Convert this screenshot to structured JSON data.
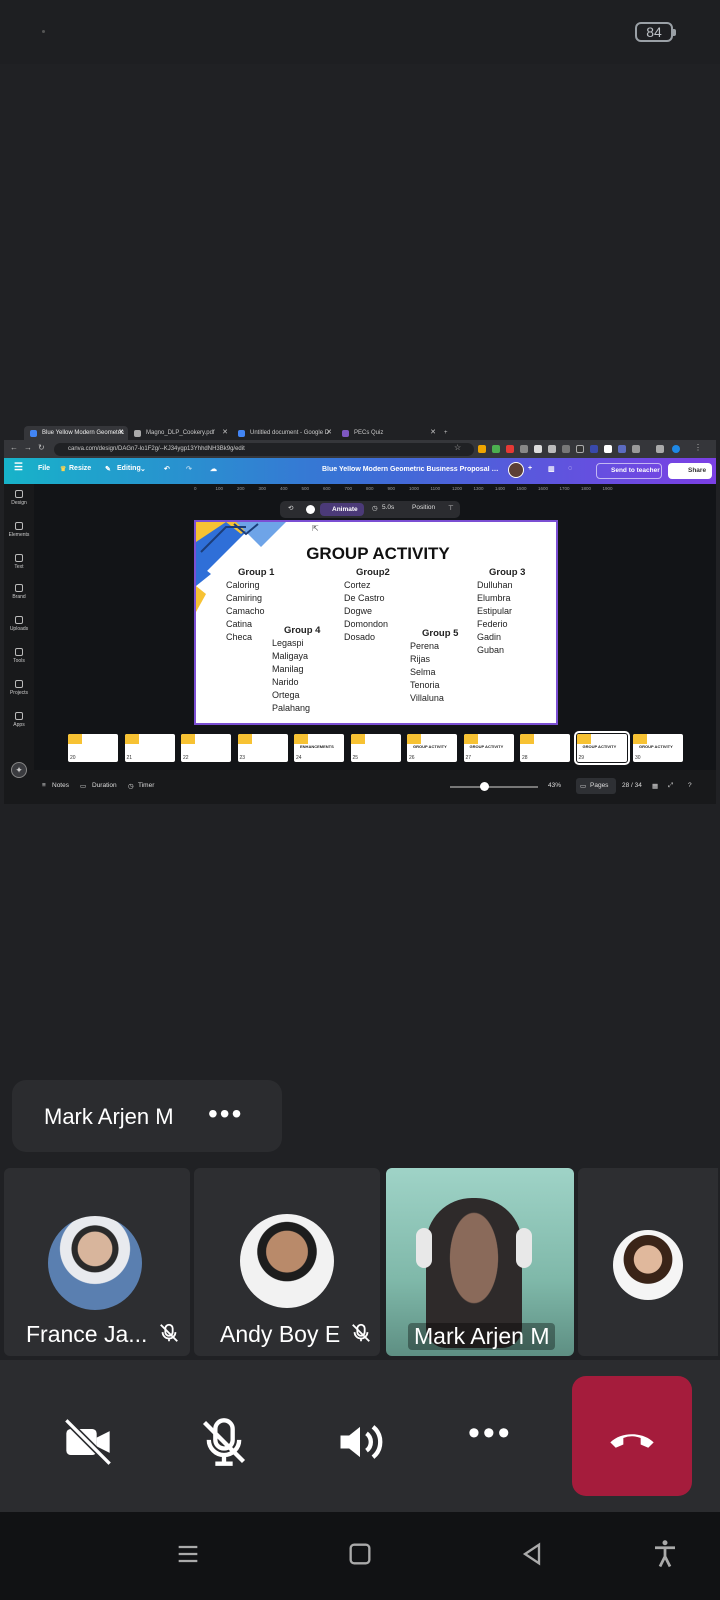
{
  "status_bar": {
    "battery": "84"
  },
  "browser": {
    "tabs": [
      {
        "label": "Blue Yellow Modern Geometric",
        "color": "#4285f4"
      },
      {
        "label": "Magno_DLP_Cookery.pdf",
        "color": "#aaaaaa"
      },
      {
        "label": "Untitled document - Google D",
        "color": "#4285f4"
      },
      {
        "label": "PECs Quiz",
        "color": "#7e57c2"
      }
    ],
    "url": "canva.com/design/DAGn7-lo1F2g/--KJ34ygp13YhhdNH3Bk9g/edit"
  },
  "canva": {
    "menu": {
      "file": "File",
      "resize": "Resize",
      "editing": "Editing"
    },
    "doc_title": "Blue Yellow Modern Geometric Business Proposal Presenta...",
    "send_to_teacher": "Send to teacher",
    "share": "Share",
    "sidebar": [
      "Design",
      "Elements",
      "Text",
      "Brand",
      "Uploads",
      "Tools",
      "Projects",
      "Apps"
    ],
    "ruler": [
      "0",
      "100",
      "200",
      "300",
      "400",
      "500",
      "600",
      "700",
      "800",
      "900",
      "1000",
      "1100",
      "1200",
      "1300",
      "1400",
      "1500",
      "1600",
      "1700",
      "1800",
      "1900"
    ],
    "toolbar": {
      "animate": "Animate",
      "duration": "5.0s",
      "position": "Position"
    },
    "slide": {
      "title": "GROUP ACTIVITY",
      "groups": [
        {
          "heading": "Group 1",
          "members": [
            "Caloring",
            "Camiring",
            "Camacho",
            "Catina",
            "Checa"
          ]
        },
        {
          "heading": "Group2",
          "members": [
            "Cortez",
            "De Castro",
            "Dogwe",
            "Domondon",
            "Dosado"
          ]
        },
        {
          "heading": "Group 3",
          "members": [
            "Dulluhan",
            "Elumbra",
            "Estipular",
            "Federio",
            "Gadin",
            "Guban"
          ]
        },
        {
          "heading": "Group 4",
          "members": [
            "Legaspi",
            "Maligaya",
            "Manilag",
            "Narido",
            "Ortega",
            "Palahang"
          ]
        },
        {
          "heading": "Group 5",
          "members": [
            "Perena",
            "Rijas",
            "Selma",
            "Tenoria",
            "Villaluna"
          ]
        }
      ]
    },
    "thumbnails": [
      {
        "num": "20",
        "text": ""
      },
      {
        "num": "21",
        "text": ""
      },
      {
        "num": "22",
        "text": ""
      },
      {
        "num": "23",
        "text": ""
      },
      {
        "num": "24",
        "text": "ENHANCEMENTS"
      },
      {
        "num": "25",
        "text": ""
      },
      {
        "num": "26",
        "text": "GROUP ACTIVITY"
      },
      {
        "num": "27",
        "text": "GROUP ACTIVITY"
      },
      {
        "num": "28",
        "text": ""
      },
      {
        "num": "29",
        "text": "GROUP ACTIVITY"
      },
      {
        "num": "30",
        "text": "GROUP ACTIVITY"
      }
    ],
    "selected_thumbnail_index": 9,
    "bottom": {
      "notes": "Notes",
      "duration": "Duration",
      "timer": "Timer",
      "zoom": "43%",
      "pages": "Pages",
      "page_count": "28 / 34"
    }
  },
  "meeting": {
    "active_speaker": "Mark Arjen M",
    "participants": [
      {
        "name": "France Ja...",
        "muted": true
      },
      {
        "name": "Andy Boy E",
        "muted": true
      },
      {
        "name": "Mark Arjen M",
        "muted": false
      },
      {
        "name": "",
        "muted": false
      }
    ],
    "controls": {
      "camera": "camera-off",
      "mic": "mic-off",
      "speaker": "speaker-on",
      "more": "more",
      "end": "end-call"
    },
    "colors": {
      "end_call": "#a51c3c",
      "tile_bg": "#2d2e31"
    }
  }
}
